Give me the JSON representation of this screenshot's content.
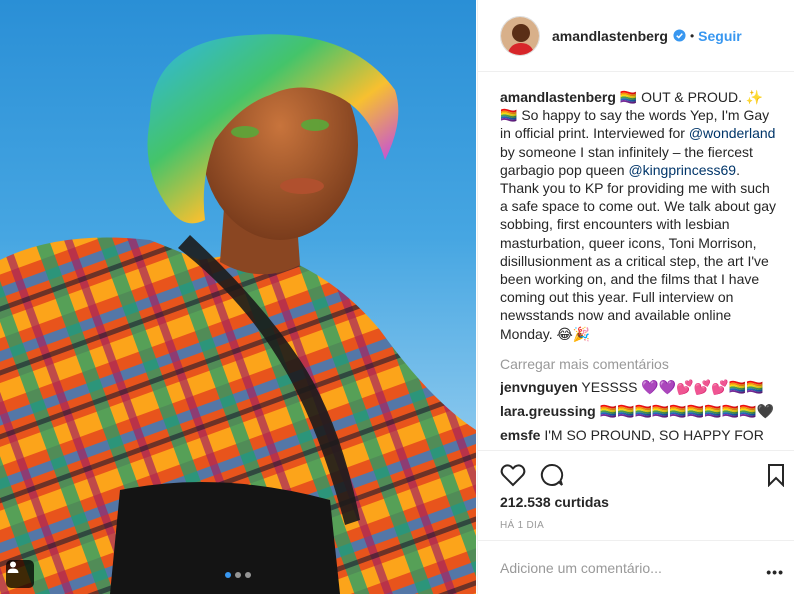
{
  "post": {
    "alt": "",
    "carousel_dots": 3,
    "active_dot": 0
  },
  "header": {
    "username": "amandlastenberg",
    "separator": "•",
    "follow_label": "Seguir"
  },
  "caption": {
    "username": "amandlastenberg",
    "part1": " 🏳️‍🌈 OUT & PROUD. ✨ 🏳️‍🌈 So happy to say the words Yep, I'm Gay in official print. Interviewed for ",
    "mention1": "@wonderland",
    "part2": " by someone I stan infinitely – the fiercest garbagio pop queen ",
    "mention2": "@kingprincess69",
    "part3": ". Thank you to KP for providing me with such a safe space to come out. We talk about gay sobbing, first encounters with lesbian masturbation, queer icons, Toni Morrison, disillusionment as a critical step, the art I've been working on, and the films that I have coming out this year. Full interview on newsstands now and available online Monday. 😂🎉"
  },
  "load_more": "Carregar mais comentários",
  "comments": [
    {
      "user": "jenvnguyen",
      "text": " YESSSS 💜💜💕💕💕🏳️‍🌈🏳️‍🌈"
    },
    {
      "user": "lara.greussing",
      "text": " 🏳️‍🌈🏳️‍🌈🏳️‍🌈🏳️‍🌈🏳️‍🌈🏳️‍🌈🏳️‍🌈🏳️‍🌈🏳️‍🌈🖤"
    },
    {
      "user": "emsfe",
      "text": " I'M SO PROUND, SO HAPPY FOR"
    }
  ],
  "likes": "212.538 curtidas",
  "time_ago": "HÁ 1 DIA",
  "add_comment_placeholder": "Adicione um comentário...",
  "more_label": "•••",
  "colors": {
    "accent": "#3897f0",
    "text": "#262626",
    "muted": "#999999",
    "mention": "#003569"
  },
  "icons": [
    "tag-people-icon",
    "heart-icon",
    "comment-icon",
    "bookmark-icon",
    "verified-badge-icon"
  ]
}
